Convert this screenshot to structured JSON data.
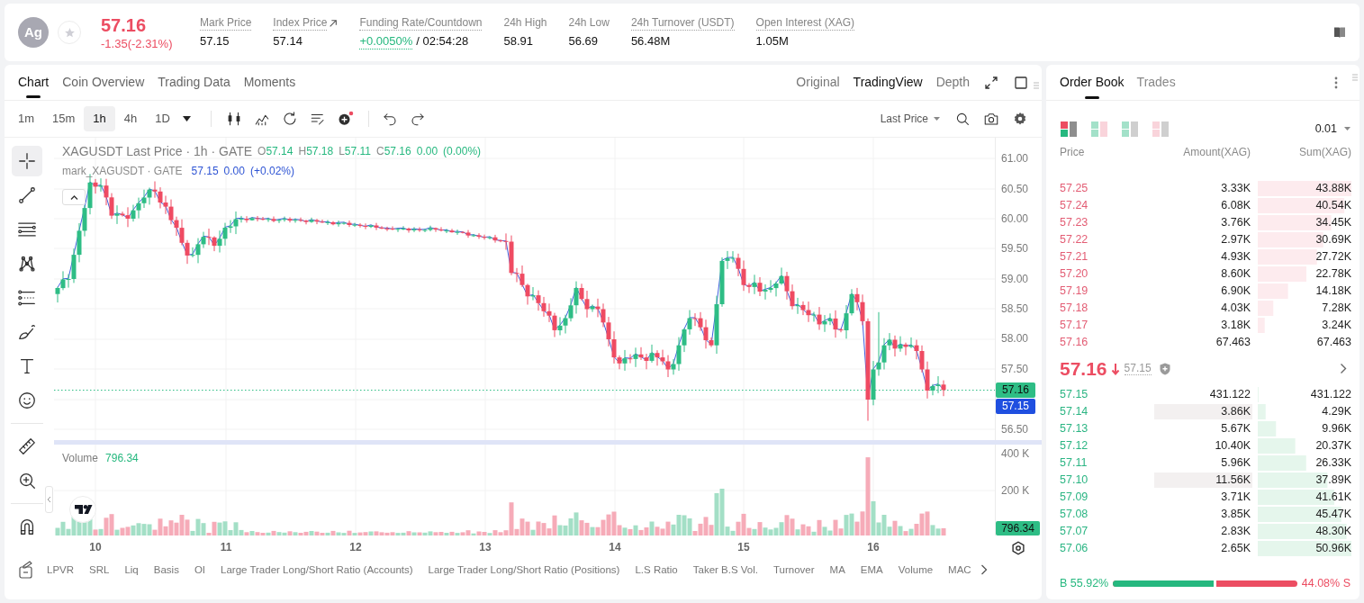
{
  "header": {
    "badge": "Ag",
    "favorite": false,
    "price": "57.16",
    "change": "-1.35(-2.31%)",
    "falling": true,
    "stats": [
      {
        "kind": "plain",
        "label": "Mark Price",
        "underlined": true,
        "external": false,
        "value": "57.15"
      },
      {
        "kind": "plain",
        "label": "Index Price",
        "underlined": true,
        "external": true,
        "value": "57.14"
      },
      {
        "kind": "funding",
        "label": "Funding Rate/Countdown",
        "underlined": true,
        "external": false,
        "value": "+0.0050%",
        "countdown": "/ 02:54:28"
      },
      {
        "kind": "plain",
        "label": "24h High",
        "underlined": false,
        "external": false,
        "value": "58.91"
      },
      {
        "kind": "plain",
        "label": "24h Low",
        "underlined": false,
        "external": false,
        "value": "56.69"
      },
      {
        "kind": "plain",
        "label": "24h Turnover (USDT)",
        "underlined": true,
        "external": false,
        "value": "56.48M"
      },
      {
        "kind": "plain",
        "label": "Open Interest (XAG)",
        "underlined": true,
        "external": false,
        "value": "1.05M"
      }
    ]
  },
  "chart_panel": {
    "tabs": [
      {
        "label": "Chart",
        "selected": true
      },
      {
        "label": "Coin Overview",
        "selected": false
      },
      {
        "label": "Trading Data",
        "selected": false
      },
      {
        "label": "Moments",
        "selected": false
      }
    ],
    "views": [
      {
        "label": "Original",
        "selected": false
      },
      {
        "label": "TradingView",
        "selected": true
      },
      {
        "label": "Depth",
        "selected": false
      }
    ],
    "intervals": [
      {
        "label": "1m",
        "selected": false
      },
      {
        "label": "15m",
        "selected": false
      },
      {
        "label": "1h",
        "selected": true
      },
      {
        "label": "4h",
        "selected": false
      },
      {
        "label": "1D",
        "selected": false
      }
    ],
    "price_source": "Last Price",
    "tool_groups": [
      [
        {
          "kind": "crosshair",
          "selected": true
        },
        {
          "kind": "trend_line",
          "selected": false
        },
        {
          "kind": "horizontal_lines",
          "selected": false
        },
        {
          "kind": "pattern",
          "selected": false
        },
        {
          "kind": "fibonacci",
          "selected": false
        },
        {
          "kind": "brush",
          "selected": false
        },
        {
          "kind": "text",
          "selected": false
        },
        {
          "kind": "emoji",
          "selected": false
        }
      ],
      [
        {
          "kind": "ruler",
          "selected": false
        },
        {
          "kind": "zoom_in",
          "selected": false
        }
      ],
      [
        {
          "kind": "magnet",
          "selected": false
        }
      ]
    ],
    "legend": {
      "title": "XAGUSDT Last Price · 1h · GATE",
      "ohlc": [
        {
          "key": "O",
          "value": "57.14"
        },
        {
          "key": "H",
          "value": "57.18"
        },
        {
          "key": "L",
          "value": "57.11"
        },
        {
          "key": "C",
          "value": "57.16"
        }
      ],
      "change": "0.00",
      "percent": "(0.00%)",
      "mark_title": "mark_XAGUSDT · GATE",
      "mark_value": "57.15",
      "mark_change": "0.00",
      "mark_percent": "(+0.02%)"
    },
    "price_axis": [
      "61.00",
      "60.50",
      "60.00",
      "59.50",
      "59.00",
      "58.50",
      "58.00",
      "57.50",
      "56.50"
    ],
    "last_price_tag": "57.16",
    "mark_price_tag": "57.15",
    "volume": {
      "label": "Volume",
      "value": "796.34",
      "axis": [
        "400 K",
        "200 K"
      ],
      "tag": "796.34"
    },
    "dates": [
      "10",
      "11",
      "12",
      "13",
      "14",
      "15",
      "16"
    ],
    "indicators": [
      "LPVR",
      "SRL",
      "Liq",
      "Basis",
      "OI",
      "Large Trader Long/Short Ratio (Accounts)",
      "Large Trader Long/Short Ratio (Positions)",
      "L.S Ratio",
      "Taker B.S Vol.",
      "Turnover",
      "MA",
      "EMA",
      "Volume",
      "MAC"
    ]
  },
  "order_book": {
    "tabs": [
      {
        "label": "Order Book",
        "selected": true
      },
      {
        "label": "Trades",
        "selected": false
      }
    ],
    "layouts": [
      {
        "kind": "mixed",
        "selected": true
      },
      {
        "kind": "paired",
        "selected": false
      },
      {
        "kind": "bids",
        "selected": false
      },
      {
        "kind": "asks",
        "selected": false
      }
    ],
    "precision": "0.01",
    "columns": [
      "Price",
      "Amount(XAG)",
      "Sum(XAG)"
    ],
    "asks": [
      {
        "price": "57.25",
        "amount": "3.33K",
        "sum": "43.88K",
        "highlighted": false
      },
      {
        "price": "57.24",
        "amount": "6.08K",
        "sum": "40.54K",
        "highlighted": false
      },
      {
        "price": "57.23",
        "amount": "3.76K",
        "sum": "34.45K",
        "highlighted": false
      },
      {
        "price": "57.22",
        "amount": "2.97K",
        "sum": "30.69K",
        "highlighted": false
      },
      {
        "price": "57.21",
        "amount": "4.93K",
        "sum": "27.72K",
        "highlighted": false
      },
      {
        "price": "57.20",
        "amount": "8.60K",
        "sum": "22.78K",
        "highlighted": false
      },
      {
        "price": "57.19",
        "amount": "6.90K",
        "sum": "14.18K",
        "highlighted": false
      },
      {
        "price": "57.18",
        "amount": "4.03K",
        "sum": "7.28K",
        "highlighted": false
      },
      {
        "price": "57.17",
        "amount": "3.18K",
        "sum": "3.24K",
        "highlighted": false
      },
      {
        "price": "57.16",
        "amount": "67.463",
        "sum": "67.463",
        "highlighted": false
      }
    ],
    "last": {
      "price": "57.16",
      "falling": true,
      "mark": "57.15"
    },
    "bids": [
      {
        "price": "57.15",
        "amount": "431.122",
        "sum": "431.122",
        "highlighted": false
      },
      {
        "price": "57.14",
        "amount": "3.86K",
        "sum": "4.29K",
        "highlighted": true
      },
      {
        "price": "57.13",
        "amount": "5.67K",
        "sum": "9.96K",
        "highlighted": false
      },
      {
        "price": "57.12",
        "amount": "10.40K",
        "sum": "20.37K",
        "highlighted": false
      },
      {
        "price": "57.11",
        "amount": "5.96K",
        "sum": "26.33K",
        "highlighted": false
      },
      {
        "price": "57.10",
        "amount": "11.56K",
        "sum": "37.89K",
        "highlighted": true
      },
      {
        "price": "57.09",
        "amount": "3.71K",
        "sum": "41.61K",
        "highlighted": false
      },
      {
        "price": "57.08",
        "amount": "3.85K",
        "sum": "45.47K",
        "highlighted": false
      },
      {
        "price": "57.07",
        "amount": "2.83K",
        "sum": "48.30K",
        "highlighted": false
      },
      {
        "price": "57.06",
        "amount": "2.65K",
        "sum": "50.96K",
        "highlighted": false
      }
    ],
    "ratio": {
      "buy": "B 55.92%",
      "sell": "44.08% S",
      "level": 0.5592
    }
  }
}
